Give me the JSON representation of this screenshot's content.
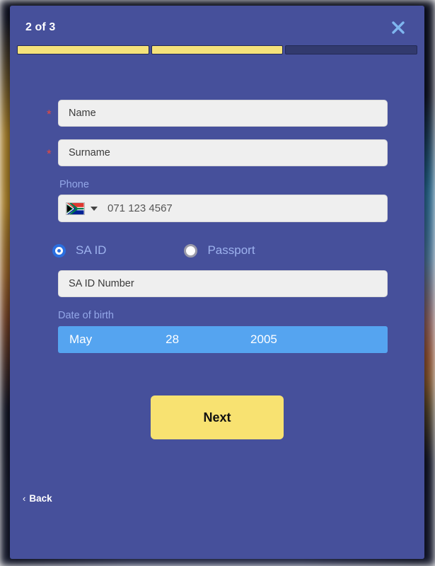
{
  "modal": {
    "step_label": "2 of 3",
    "close_icon": "close-x-icon",
    "progress": {
      "total_segments": 3,
      "completed_segments": 2,
      "fill_color": "#f5e27a",
      "empty_color": "#323a6e"
    },
    "background_color": "#46509b"
  },
  "form": {
    "name": {
      "required_marker": "*",
      "placeholder": "Name",
      "value": ""
    },
    "surname": {
      "required_marker": "*",
      "placeholder": "Surname",
      "value": ""
    },
    "phone": {
      "label": "Phone",
      "country_flag": "south-africa-flag-icon",
      "dropdown_icon": "chevron-down-icon",
      "placeholder": "071 123 4567",
      "value": ""
    },
    "id_type": {
      "options": [
        {
          "label": "SA ID",
          "selected": true
        },
        {
          "label": "Passport",
          "selected": false
        }
      ],
      "selected_color": "#2a6fe0",
      "label_color": "#9db2ee"
    },
    "id_number": {
      "placeholder": "SA ID Number",
      "value": ""
    },
    "date_of_birth": {
      "label": "Date of birth",
      "month": "May",
      "day": "28",
      "year": "2005",
      "bar_color": "#55a4f0"
    }
  },
  "actions": {
    "next_label": "Next",
    "next_color": "#f8e271",
    "back_label": "Back",
    "back_chevron": "‹"
  }
}
